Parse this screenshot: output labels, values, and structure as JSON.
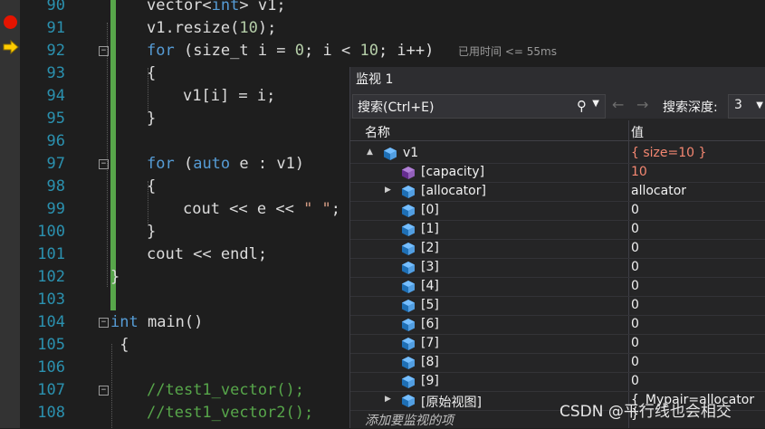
{
  "editor": {
    "lines": [
      {
        "n": "90",
        "indent": 2,
        "tokens": [
          {
            "t": "vector<",
            "c": ""
          },
          {
            "t": "int",
            "c": "kw"
          },
          {
            "t": "> v1;",
            "c": ""
          }
        ]
      },
      {
        "n": "91",
        "indent": 2,
        "tokens": [
          {
            "t": "v1.resize(",
            "c": ""
          },
          {
            "t": "10",
            "c": "num"
          },
          {
            "t": ");",
            "c": ""
          }
        ]
      },
      {
        "n": "92",
        "indent": 2,
        "tokens": [
          {
            "t": "for",
            "c": "kw"
          },
          {
            "t": " (size_t i = ",
            "c": ""
          },
          {
            "t": "0",
            "c": "num"
          },
          {
            "t": "; i < ",
            "c": ""
          },
          {
            "t": "10",
            "c": "num"
          },
          {
            "t": "; i++)",
            "c": ""
          }
        ]
      },
      {
        "n": "93",
        "indent": 2,
        "tokens": [
          {
            "t": "{",
            "c": ""
          }
        ]
      },
      {
        "n": "94",
        "indent": 3,
        "tokens": [
          {
            "t": "v1[i] = i;",
            "c": ""
          }
        ]
      },
      {
        "n": "95",
        "indent": 2,
        "tokens": [
          {
            "t": "}",
            "c": ""
          }
        ]
      },
      {
        "n": "96",
        "indent": 2,
        "tokens": []
      },
      {
        "n": "97",
        "indent": 2,
        "tokens": [
          {
            "t": "for",
            "c": "kw"
          },
          {
            "t": " (",
            "c": ""
          },
          {
            "t": "auto",
            "c": "kw"
          },
          {
            "t": " e : v1)",
            "c": ""
          }
        ]
      },
      {
        "n": "98",
        "indent": 2,
        "tokens": [
          {
            "t": "{",
            "c": ""
          }
        ]
      },
      {
        "n": "99",
        "indent": 3,
        "tokens": [
          {
            "t": "cout << e << ",
            "c": ""
          },
          {
            "t": "\" \"",
            "c": "str"
          },
          {
            "t": ";",
            "c": ""
          }
        ]
      },
      {
        "n": "100",
        "indent": 2,
        "tokens": [
          {
            "t": "}",
            "c": ""
          }
        ]
      },
      {
        "n": "101",
        "indent": 2,
        "tokens": [
          {
            "t": "cout << endl;",
            "c": ""
          }
        ]
      },
      {
        "n": "102",
        "indent": 0,
        "tokens": [
          {
            "t": "}",
            "c": ""
          }
        ]
      },
      {
        "n": "103",
        "indent": 0,
        "tokens": []
      },
      {
        "n": "104",
        "indent": 0,
        "tokens": [
          {
            "t": "int",
            "c": "kw"
          },
          {
            "t": " main()",
            "c": ""
          }
        ]
      },
      {
        "n": "105",
        "indent": 0,
        "tokens": [
          {
            "t": " {",
            "c": ""
          }
        ]
      },
      {
        "n": "106",
        "indent": 0,
        "tokens": []
      },
      {
        "n": "107",
        "indent": 2,
        "tokens": [
          {
            "t": "//test1_vector();",
            "c": "cm"
          }
        ]
      },
      {
        "n": "108",
        "indent": 2,
        "tokens": [
          {
            "t": "//test1_vector2();",
            "c": "cm"
          }
        ]
      }
    ],
    "elapsed_hint": "已用时间 <= 55ms"
  },
  "watch": {
    "title": "监视 1",
    "search_label": "搜索(Ctrl+E)",
    "depth_label": "搜索深度:",
    "depth_value": "3",
    "col_name": "名称",
    "col_value": "值",
    "rows": [
      {
        "name": "v1",
        "value": "{ size=10 }",
        "level": 0,
        "expander": "▲",
        "icon": "blue",
        "changed": true
      },
      {
        "name": "[capacity]",
        "value": "10",
        "level": 1,
        "expander": "",
        "icon": "purple",
        "changed": true
      },
      {
        "name": "[allocator]",
        "value": "allocator",
        "level": 1,
        "expander": "▶",
        "icon": "blue",
        "changed": false
      },
      {
        "name": "[0]",
        "value": "0",
        "level": 1,
        "expander": "",
        "icon": "blue",
        "changed": false
      },
      {
        "name": "[1]",
        "value": "0",
        "level": 1,
        "expander": "",
        "icon": "blue",
        "changed": false
      },
      {
        "name": "[2]",
        "value": "0",
        "level": 1,
        "expander": "",
        "icon": "blue",
        "changed": false
      },
      {
        "name": "[3]",
        "value": "0",
        "level": 1,
        "expander": "",
        "icon": "blue",
        "changed": false
      },
      {
        "name": "[4]",
        "value": "0",
        "level": 1,
        "expander": "",
        "icon": "blue",
        "changed": false
      },
      {
        "name": "[5]",
        "value": "0",
        "level": 1,
        "expander": "",
        "icon": "blue",
        "changed": false
      },
      {
        "name": "[6]",
        "value": "0",
        "level": 1,
        "expander": "",
        "icon": "blue",
        "changed": false
      },
      {
        "name": "[7]",
        "value": "0",
        "level": 1,
        "expander": "",
        "icon": "blue",
        "changed": false
      },
      {
        "name": "[8]",
        "value": "0",
        "level": 1,
        "expander": "",
        "icon": "blue",
        "changed": false
      },
      {
        "name": "[9]",
        "value": "0",
        "level": 1,
        "expander": "",
        "icon": "blue",
        "changed": false
      },
      {
        "name": "[原始视图]",
        "value": "{_Mypair=allocator }",
        "level": 1,
        "expander": "▶",
        "icon": "blue",
        "changed": false
      }
    ],
    "add_watch": "添加要监视的项"
  },
  "watermark": "CSDN @平行线也会相交",
  "colors": {
    "keyword": "#569cd6",
    "comment": "#57a64a",
    "number": "#b5cea8",
    "string": "#d69d85",
    "changed_value": "#f48771"
  }
}
